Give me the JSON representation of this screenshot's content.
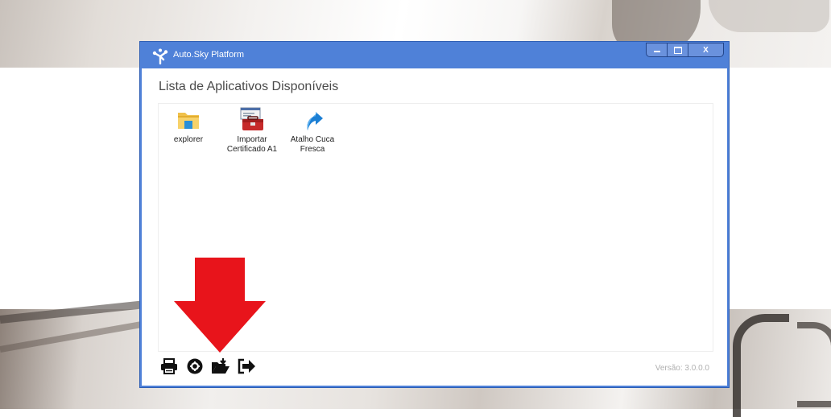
{
  "window": {
    "title": "Auto.Sky Platform",
    "controls": {
      "close_label": "X"
    }
  },
  "main": {
    "heading": "Lista de Aplicativos Disponíveis",
    "apps": [
      {
        "label": "explorer",
        "icon": "folder-icon"
      },
      {
        "label": "Importar Certificado A1",
        "icon": "toolbox-icon"
      },
      {
        "label": "Atalho Cuca Fresca",
        "icon": "shortcut-arrow-icon"
      }
    ]
  },
  "toolbar": {
    "buttons": [
      {
        "icon": "printer-icon"
      },
      {
        "icon": "gear-icon"
      },
      {
        "icon": "folder-open-icon"
      },
      {
        "icon": "sign-out-icon"
      }
    ],
    "version": "Versão: 3.0.0.0"
  },
  "colors": {
    "titlebar": "#4f81d8",
    "arrow": "#e8141b"
  }
}
